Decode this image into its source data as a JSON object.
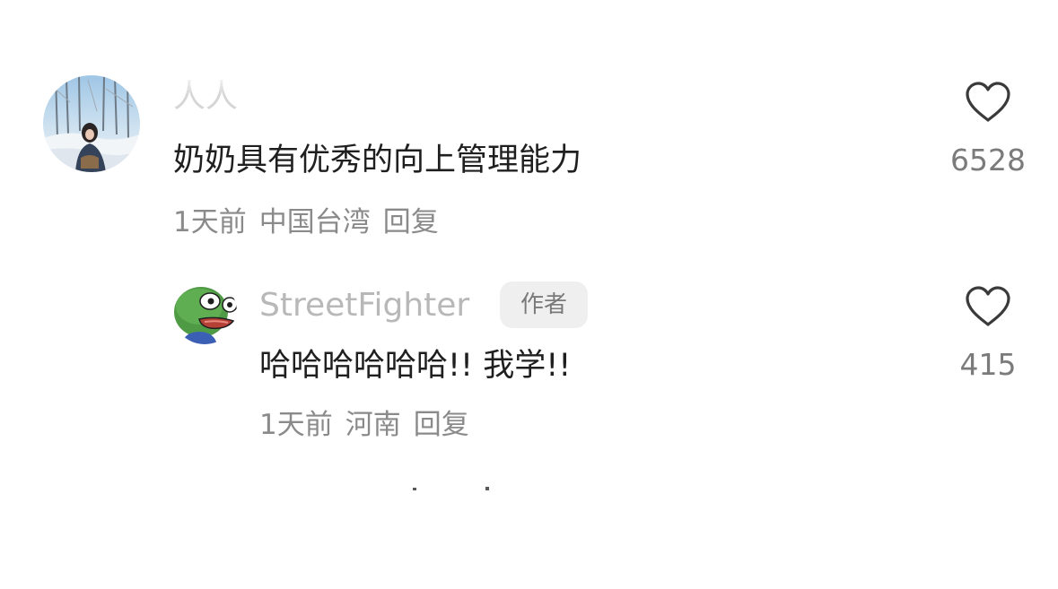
{
  "comments": [
    {
      "username": "人人",
      "text": "奶奶具有优秀的向上管理能力",
      "time": "1天前",
      "location": "中国台湾",
      "reply_label": "回复",
      "like_count": "6528",
      "like_icon": "heart-outline-icon",
      "avatar": "winter-forest-person-avatar"
    },
    {
      "username": "StreetFighter",
      "badge": "作者",
      "text": "哈哈哈哈哈哈!! 我学!!",
      "time": "1天前",
      "location": "河南",
      "reply_label": "回复",
      "like_count": "415",
      "like_icon": "heart-outline-icon",
      "avatar": "green-frog-avatar"
    }
  ],
  "colors": {
    "primary_text": "#1f1f1f",
    "secondary_text": "#8a8a8a",
    "badge_bg": "#efefef",
    "icon_stroke": "#3a3a3a"
  }
}
